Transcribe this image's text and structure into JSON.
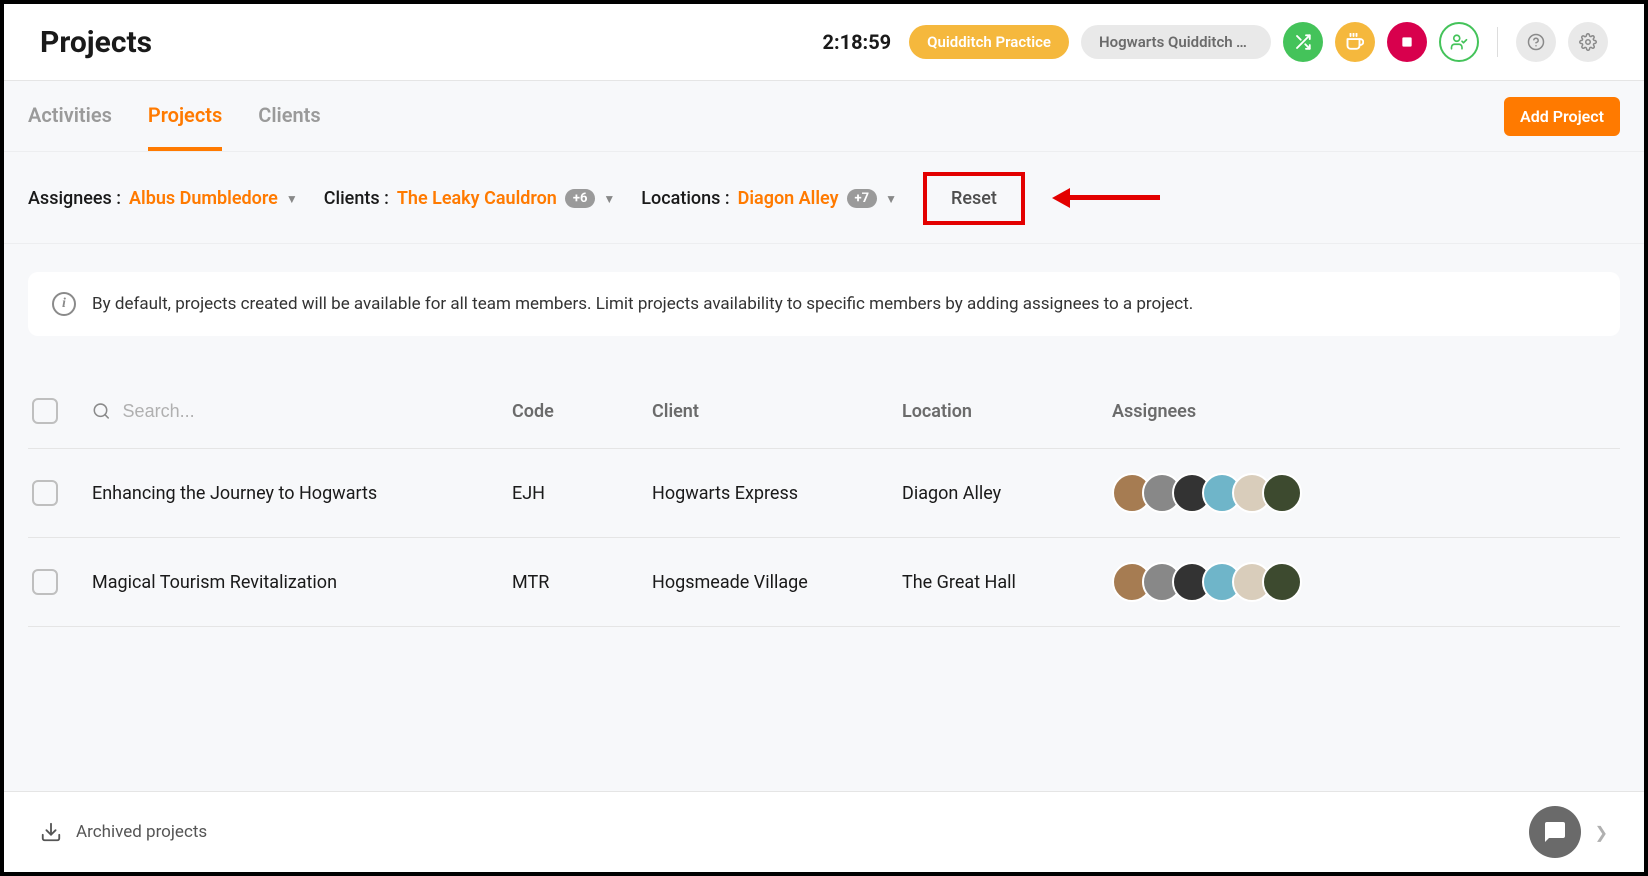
{
  "header": {
    "title": "Projects",
    "timer": "2:18:59",
    "pill_active": "Quidditch Practice",
    "pill_secondary": "Hogwarts Quidditch To..."
  },
  "tabs": {
    "items": [
      {
        "label": "Activities",
        "active": false
      },
      {
        "label": "Projects",
        "active": true
      },
      {
        "label": "Clients",
        "active": false
      }
    ],
    "add_button": "Add Project"
  },
  "filters": {
    "assignees": {
      "label": "Assignees :",
      "value": "Albus Dumbledore"
    },
    "clients": {
      "label": "Clients :",
      "value": "The Leaky Cauldron",
      "count": "+6"
    },
    "locations": {
      "label": "Locations :",
      "value": "Diagon Alley",
      "count": "+7"
    },
    "reset": "Reset"
  },
  "info": {
    "text": "By default, projects created will be available for all team members. Limit projects availability to specific members by adding assignees to a project."
  },
  "table": {
    "search_placeholder": "Search...",
    "cols": {
      "code": "Code",
      "client": "Client",
      "location": "Location",
      "assignees": "Assignees"
    },
    "rows": [
      {
        "name": "Enhancing the Journey to Hogwarts",
        "code": "EJH",
        "client": "Hogwarts Express",
        "location": "Diagon Alley",
        "assignee_colors": [
          "#a67c52",
          "#888888",
          "#333333",
          "#6fb5c9",
          "#d9cdbb",
          "#3d4a2f"
        ]
      },
      {
        "name": "Magical Tourism Revitalization",
        "code": "MTR",
        "client": "Hogsmeade Village",
        "location": "The Great Hall",
        "assignee_colors": [
          "#a67c52",
          "#888888",
          "#333333",
          "#6fb5c9",
          "#d9cdbb",
          "#3d4a2f"
        ]
      }
    ]
  },
  "footer": {
    "archived": "Archived projects"
  }
}
